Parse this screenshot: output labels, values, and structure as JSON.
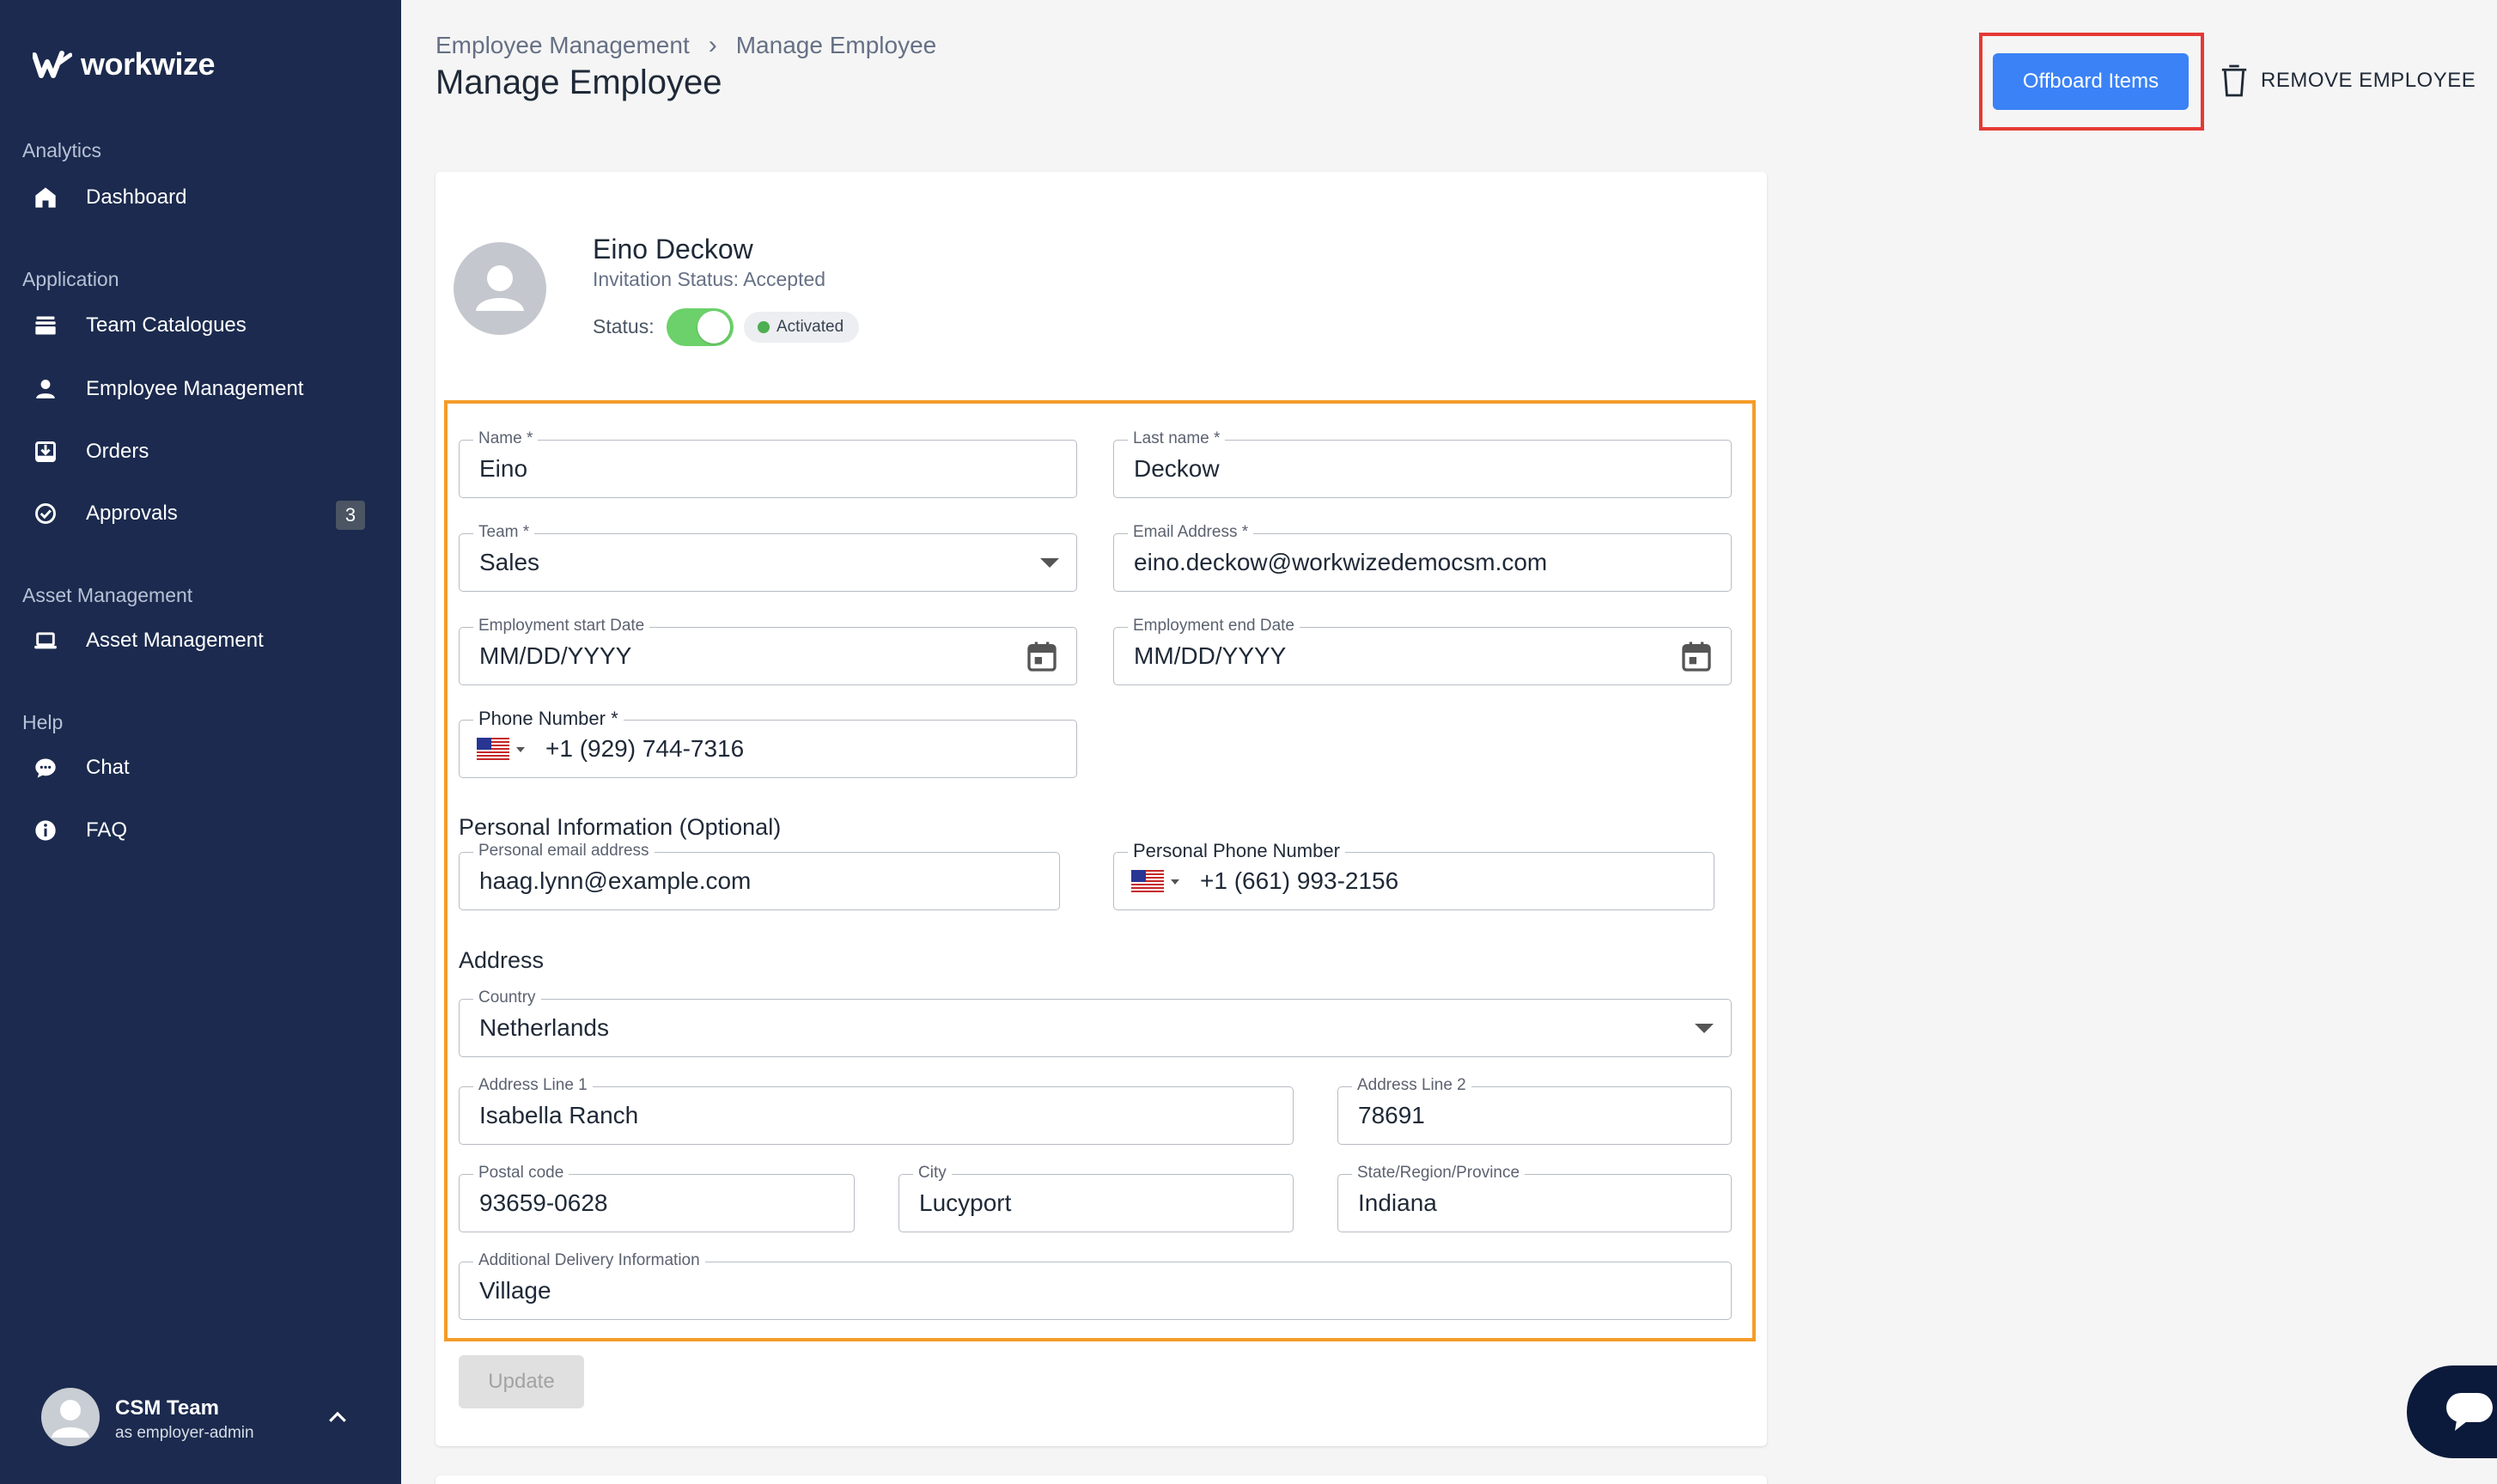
{
  "app": {
    "logo_text": "workwize"
  },
  "sidebar": {
    "sections": [
      {
        "label": "Analytics"
      },
      {
        "label": "Application"
      },
      {
        "label": "Asset Management"
      },
      {
        "label": "Help"
      }
    ],
    "items": [
      {
        "label": "Dashboard",
        "icon": "home-icon"
      },
      {
        "label": "Team Catalogues",
        "icon": "stack-icon"
      },
      {
        "label": "Employee Management",
        "icon": "person-icon"
      },
      {
        "label": "Orders",
        "icon": "download-box-icon"
      },
      {
        "label": "Approvals",
        "icon": "check-circle-icon",
        "badge": "3"
      },
      {
        "label": "Asset Management",
        "icon": "laptop-icon"
      },
      {
        "label": "Chat",
        "icon": "chat-bubble-icon"
      },
      {
        "label": "FAQ",
        "icon": "info-icon"
      }
    ],
    "user": {
      "name": "CSM Team",
      "role": "as employer-admin"
    }
  },
  "header": {
    "breadcrumb": [
      "Employee Management",
      "Manage Employee"
    ],
    "title": "Manage Employee",
    "offboard_label": "Offboard Items",
    "remove_label": "REMOVE EMPLOYEE"
  },
  "profile": {
    "name": "Eino Deckow",
    "invitation": "Invitation Status: Accepted",
    "status_label": "Status:",
    "status_chip": "Activated",
    "status_on": true
  },
  "form": {
    "name": {
      "label": "Name *",
      "value": "Eino"
    },
    "last_name": {
      "label": "Last name *",
      "value": "Deckow"
    },
    "team": {
      "label": "Team *",
      "value": "Sales"
    },
    "email": {
      "label": "Email Address *",
      "value": "eino.deckow@workwizedemocsm.com"
    },
    "start_date": {
      "label": "Employment start Date",
      "placeholder": "MM/DD/YYYY"
    },
    "end_date": {
      "label": "Employment end Date",
      "placeholder": "MM/DD/YYYY"
    },
    "phone": {
      "label": "Phone Number *",
      "value": "+1 (929) 744-7316"
    },
    "personal_heading": "Personal Information (Optional)",
    "personal_email": {
      "label": "Personal email address",
      "value": "haag.lynn@example.com"
    },
    "personal_phone": {
      "label": "Personal Phone Number",
      "value": "+1 (661) 993-2156"
    },
    "address_heading": "Address",
    "country": {
      "label": "Country",
      "value": "Netherlands"
    },
    "address1": {
      "label": "Address Line 1",
      "value": "Isabella Ranch"
    },
    "address2": {
      "label": "Address Line 2",
      "value": "78691"
    },
    "postal": {
      "label": "Postal code",
      "value": "93659-0628"
    },
    "city": {
      "label": "City",
      "value": "Lucyport"
    },
    "state": {
      "label": "State/Region/Province",
      "value": "Indiana"
    },
    "delivery": {
      "label": "Additional Delivery Information",
      "value": "Village"
    },
    "update_label": "Update"
  },
  "colors": {
    "sidebar_bg": "#1b2a4e",
    "primary": "#3b82f6",
    "highlight_red": "#e53935",
    "highlight_orange": "#f39c2a",
    "toggle_on": "#6cd16a"
  }
}
